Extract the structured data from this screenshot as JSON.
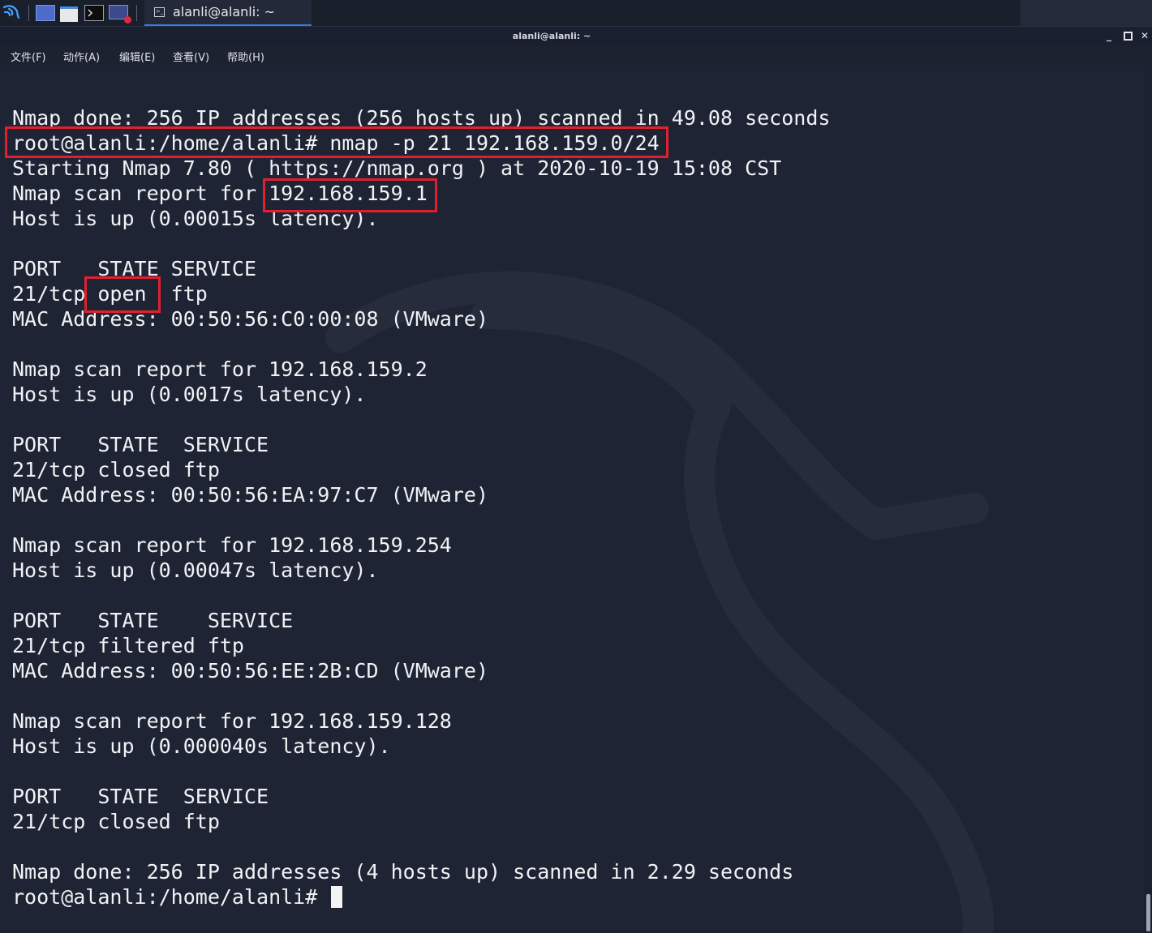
{
  "taskbar": {
    "window_button_label": "alanli@alanli: ~",
    "icons": [
      "kali-menu-icon",
      "desktop-icon",
      "file-manager-icon",
      "terminal-icon",
      "screen-recorder-icon"
    ]
  },
  "window": {
    "title": "alanli@alanli: ~",
    "controls": {
      "minimize": "_",
      "close": "✕"
    }
  },
  "menu": {
    "file": "文件(F)",
    "action": "动作(A)",
    "edit": "编辑(E)",
    "view": "查看(V)",
    "help": "帮助(H)"
  },
  "terminal": {
    "lines": [
      "Nmap done: 256 IP addresses (256 hosts up) scanned in 49.08 seconds",
      "root@alanli:/home/alanli# nmap -p 21 192.168.159.0/24",
      "Starting Nmap 7.80 ( https://nmap.org ) at 2020-10-19 15:08 CST",
      "Nmap scan report for 192.168.159.1",
      "Host is up (0.00015s latency).",
      "",
      "PORT   STATE SERVICE",
      "21/tcp open  ftp",
      "MAC Address: 00:50:56:C0:00:08 (VMware)",
      "",
      "Nmap scan report for 192.168.159.2",
      "Host is up (0.0017s latency).",
      "",
      "PORT   STATE  SERVICE",
      "21/tcp closed ftp",
      "MAC Address: 00:50:56:EA:97:C7 (VMware)",
      "",
      "Nmap scan report for 192.168.159.254",
      "Host is up (0.00047s latency).",
      "",
      "PORT   STATE    SERVICE",
      "21/tcp filtered ftp",
      "MAC Address: 00:50:56:EE:2B:CD (VMware)",
      "",
      "Nmap scan report for 192.168.159.128",
      "Host is up (0.000040s latency).",
      "",
      "PORT   STATE  SERVICE",
      "21/tcp closed ftp",
      "",
      "Nmap done: 256 IP addresses (4 hosts up) scanned in 2.29 seconds"
    ],
    "prompt": "root@alanli:/home/alanli# ",
    "highlight_color": "#e0202e"
  }
}
